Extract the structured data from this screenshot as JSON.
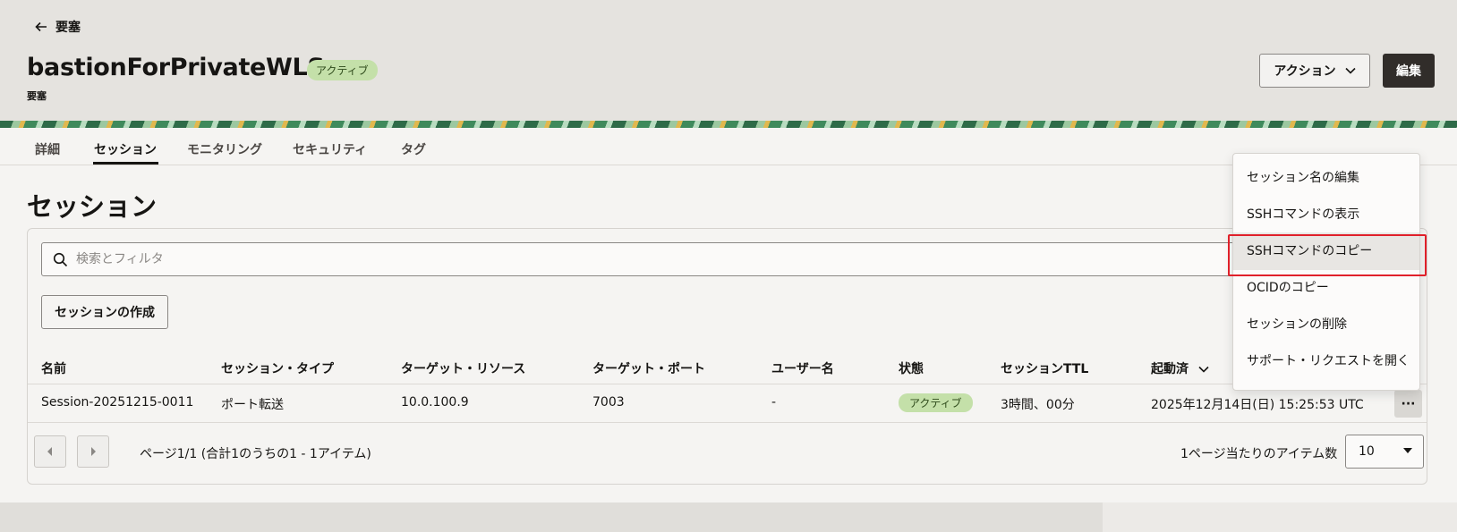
{
  "header": {
    "back_label": "要塞",
    "title": "bastionForPrivateWLS",
    "badge": "アクティブ",
    "subtitle": "要塞",
    "action_label": "アクション",
    "edit_label": "編集"
  },
  "tabs": [
    {
      "label": "詳細"
    },
    {
      "label": "セッション"
    },
    {
      "label": "モニタリング"
    },
    {
      "label": "セキュリティ"
    },
    {
      "label": "タグ"
    }
  ],
  "active_tab": "セッション",
  "section_title": "セッション",
  "search": {
    "placeholder": "検索とフィルタ"
  },
  "create_label": "セッションの作成",
  "table": {
    "columns": [
      "名前",
      "セッション・タイプ",
      "ターゲット・リソース",
      "ターゲット・ポート",
      "ユーザー名",
      "状態",
      "セッションTTL",
      "起動済"
    ],
    "rows": [
      {
        "name": "Session-20251215-0011",
        "type": "ポート転送",
        "resource": "10.0.100.9",
        "port": "7003",
        "user": "-",
        "state": "アクティブ",
        "ttl": "3時間、00分",
        "started": "2025年12月14日(日) 15:25:53 UTC",
        "menu": "···"
      }
    ]
  },
  "pagination": {
    "text": "ページ1/1 (合計1のうちの1 - 1アイテム)",
    "per_page_label": "1ページ当たりのアイテム数",
    "per_page_value": "10"
  },
  "menu": {
    "items": [
      {
        "label": "セッション名の編集"
      },
      {
        "label": "SSHコマンドの表示"
      },
      {
        "label": "SSHコマンドのコピー"
      },
      {
        "label": "OCIDのコピー"
      },
      {
        "label": "セッションの削除"
      },
      {
        "label": "サポート・リクエストを開く"
      }
    ],
    "highlighted": "SSHコマンドのコピー"
  },
  "colors": {
    "status_badge_bg": "#c4e0a9",
    "edit_button_bg": "#312d2a",
    "highlight_border": "#e0202a"
  }
}
